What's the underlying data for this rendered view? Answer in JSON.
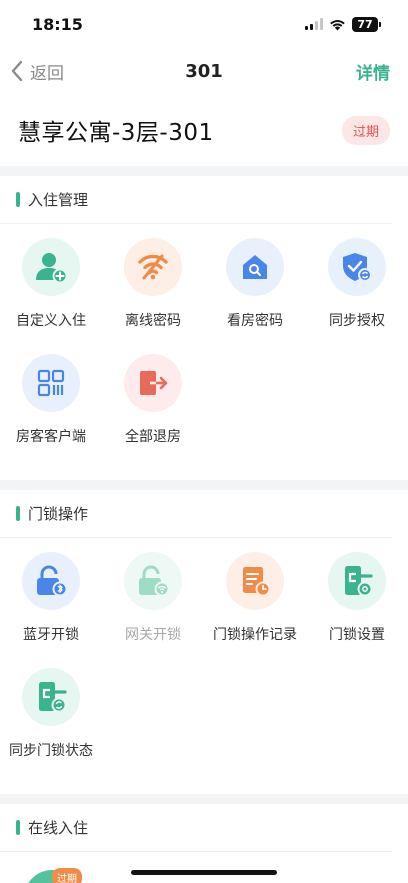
{
  "status": {
    "time": "18:15",
    "battery": "77"
  },
  "nav": {
    "back_label": "返回",
    "title": "301",
    "detail_label": "详情"
  },
  "header": {
    "room_name": "慧享公寓-3层-301",
    "status_badge": "过期"
  },
  "checkin": {
    "title": "入住管理",
    "items": [
      {
        "label": "自定义入住",
        "icon": "user-add-icon"
      },
      {
        "label": "离线密码",
        "icon": "wifi-off-icon"
      },
      {
        "label": "看房密码",
        "icon": "house-search-icon"
      },
      {
        "label": "同步授权",
        "icon": "shield-sync-icon"
      },
      {
        "label": "房客客户端",
        "icon": "qr-code-icon"
      },
      {
        "label": "全部退房",
        "icon": "exit-icon"
      }
    ]
  },
  "lock": {
    "title": "门锁操作",
    "items": [
      {
        "label": "蓝牙开锁",
        "icon": "bluetooth-lock-icon"
      },
      {
        "label": "网关开锁",
        "icon": "gateway-lock-icon"
      },
      {
        "label": "门锁操作记录",
        "icon": "record-icon"
      },
      {
        "label": "门锁设置",
        "icon": "lock-settings-icon"
      },
      {
        "label": "同步门锁状态",
        "icon": "lock-sync-icon"
      }
    ]
  },
  "online": {
    "title": "在线入住",
    "badge": "过期"
  },
  "colors": {
    "accent": "#3ab38f",
    "danger": "#e05454"
  }
}
